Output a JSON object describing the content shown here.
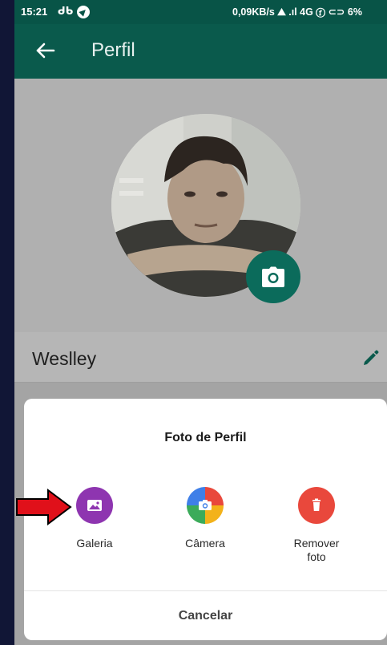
{
  "status_bar": {
    "time": "15:21",
    "notification": "ᑯᑲ",
    "right": "0,09KB/s ⛰ .ıl 4G ⓕ ⊂⊃ 6%"
  },
  "app_bar": {
    "title": "Perfil",
    "back_icon": "arrow-left-icon"
  },
  "profile": {
    "name": "Weslley",
    "camera_icon": "camera-icon",
    "edit_icon": "pencil-icon"
  },
  "sheet": {
    "title": "Foto de Perfil",
    "options": [
      {
        "label": "Galeria",
        "icon": "image-icon",
        "color": "#8e35b0"
      },
      {
        "label": "Câmera",
        "icon": "camera-icon",
        "color": "#3f7fe8"
      },
      {
        "label": "Remover\nfoto",
        "icon": "trash-icon",
        "color": "#e9483c"
      }
    ],
    "cancel_label": "Cancelar"
  },
  "colors": {
    "brand_dark": "#085447",
    "brand": "#0a5a4c",
    "annotation_arrow": "#e0101a"
  }
}
